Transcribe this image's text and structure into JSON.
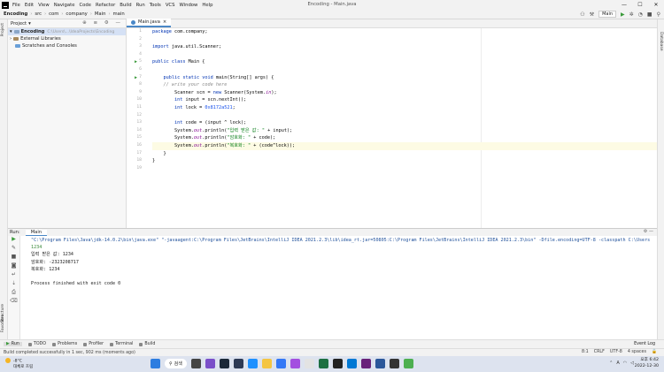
{
  "window": {
    "title": "Encoding - Main.java",
    "controls": [
      "—",
      "☐",
      "✕"
    ]
  },
  "menu": [
    "File",
    "Edit",
    "View",
    "Navigate",
    "Code",
    "Refactor",
    "Build",
    "Run",
    "Tools",
    "VCS",
    "Window",
    "Help"
  ],
  "breadcrumb": [
    "Encoding",
    "src",
    "com",
    "company",
    "Main",
    "main"
  ],
  "run_config": "Main",
  "left_tools": [
    "Project",
    "Structure",
    "Favorites"
  ],
  "right_tools": [
    "Database"
  ],
  "project": {
    "header": "Project",
    "items": [
      {
        "label": "Encoding",
        "path": "C:\\Users\\...\\IdeaProjects\\Encoding"
      },
      {
        "label": "External Libraries",
        "path": ""
      },
      {
        "label": "Scratches and Consoles",
        "path": ""
      }
    ]
  },
  "editor": {
    "tab": "Main.java",
    "line_numbers": [
      "1",
      "2",
      "3",
      "4",
      "5",
      "6",
      "7",
      "8",
      "9",
      "10",
      "11",
      "12",
      "13",
      "14",
      "15",
      "16",
      "17",
      "18",
      "19"
    ]
  },
  "run": {
    "label": "Run:",
    "tab": "Main",
    "console": [
      "\"C:\\Program Files\\Java\\jdk-14.0.2\\bin\\java.exe\" \"-javaagent:C:\\Program Files\\JetBrains\\IntelliJ IDEA 2021.2.3\\lib\\idea_rt.jar=50805:C:\\Program Files\\JetBrains\\IntelliJ IDEA 2021.2.3\\bin\" -Dfile.encoding=UTF-8 -classpath C:\\Users",
      "1234",
      "입력 받은 값: 1234",
      "암호화: -2323208717",
      "복호화: 1234",
      "",
      "Process finished with exit code 0"
    ]
  },
  "bottom_tabs": [
    "Run",
    "TODO",
    "Problems",
    "Profiler",
    "Terminal",
    "Build"
  ],
  "event_log": "Event Log",
  "status": {
    "message": "Build completed successfully in 1 sec, 902 ms (moments ago)",
    "right": [
      "8:1",
      "CRLF",
      "UTF-8",
      "4 spaces"
    ]
  },
  "taskbar": {
    "weather_temp": "-8°C",
    "weather_desc": "대체로 흐림",
    "search": "검색",
    "time": "오후 6:42",
    "date": "2022-12-30",
    "lang": "A"
  }
}
